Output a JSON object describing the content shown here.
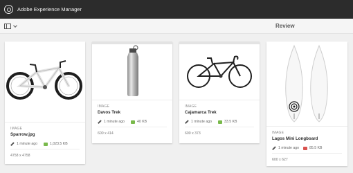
{
  "app": {
    "title": "Adobe Experience Manager"
  },
  "toolbar": {
    "view_title": "Review"
  },
  "cards": [
    {
      "context": "IMAGE",
      "title": "Sparrow.jpg",
      "modified": "1 minute ago",
      "size": "1,023.5 KB",
      "dimensions": "4758 x 4758",
      "review": "approved"
    },
    {
      "context": "IMAGE",
      "title": "Davos Trek",
      "modified": "1 minute ago",
      "size": "40 KB",
      "dimensions": "600 x 414",
      "review": "approved"
    },
    {
      "context": "IMAGE",
      "title": "Cajamarca Trek",
      "modified": "1 minute ago",
      "size": "33.5 KB",
      "dimensions": "600 x 373",
      "review": "approved"
    },
    {
      "context": "IMAGE",
      "title": "Lagos Mini Longboard",
      "modified": "1 minute ago",
      "size": "85.5 KB",
      "dimensions": "600 x 627",
      "review": "rejected"
    }
  ],
  "colors": {
    "header": "#2c2c2c",
    "approved": "#79b94b",
    "rejected": "#d9534f"
  }
}
